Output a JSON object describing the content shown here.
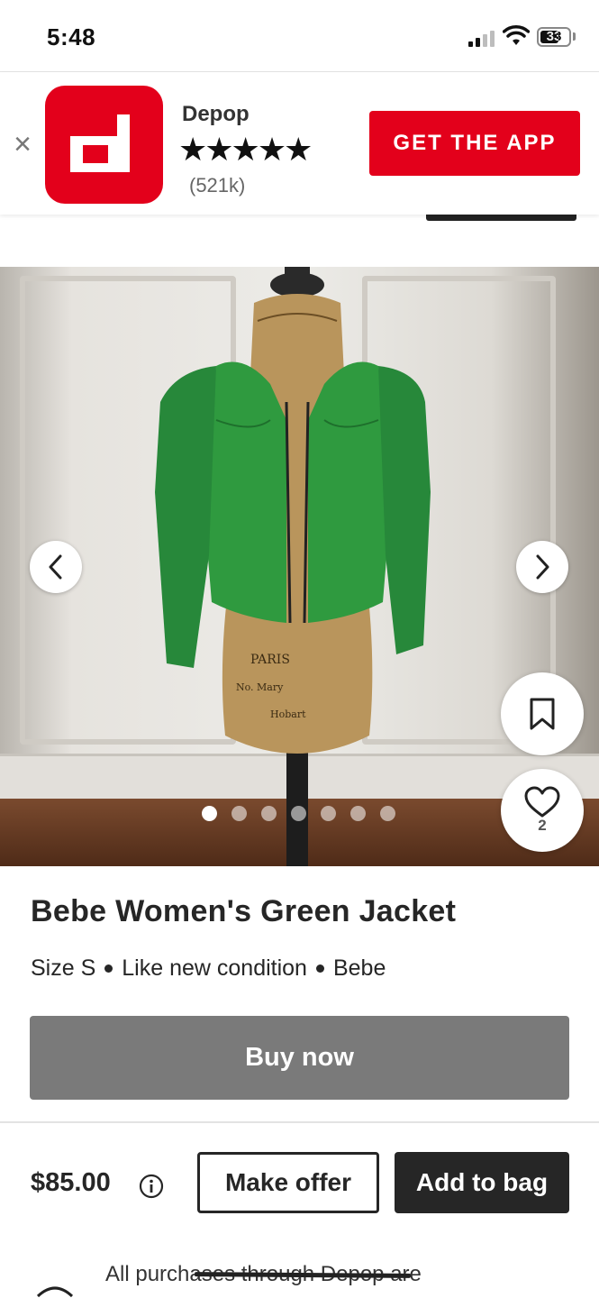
{
  "status_bar": {
    "time": "5:48",
    "battery": "33"
  },
  "app_banner": {
    "app_name": "Depop",
    "rating_stars": "★★★★★",
    "review_count": "(521k)",
    "cta_label": "GET THE APP",
    "logo_letter": "d",
    "brand_color": "#e3001b"
  },
  "gallery": {
    "image_count": 7,
    "active_index": 0,
    "likes": "2"
  },
  "product": {
    "title": "Bebe Women's Green Jacket",
    "size": "Size S",
    "condition": "Like new condition",
    "brand": "Bebe",
    "buy_now_label": "Buy now",
    "price": "$85.00",
    "make_offer_label": "Make offer",
    "add_to_bag_label": "Add to bag"
  },
  "footer": {
    "protection_text": "All purchases through Depop are"
  },
  "colors": {
    "accent_red": "#e3001b",
    "dark": "#262626",
    "disabled_gray": "#7a7a7a",
    "jacket_green": "#2f9a3f"
  }
}
